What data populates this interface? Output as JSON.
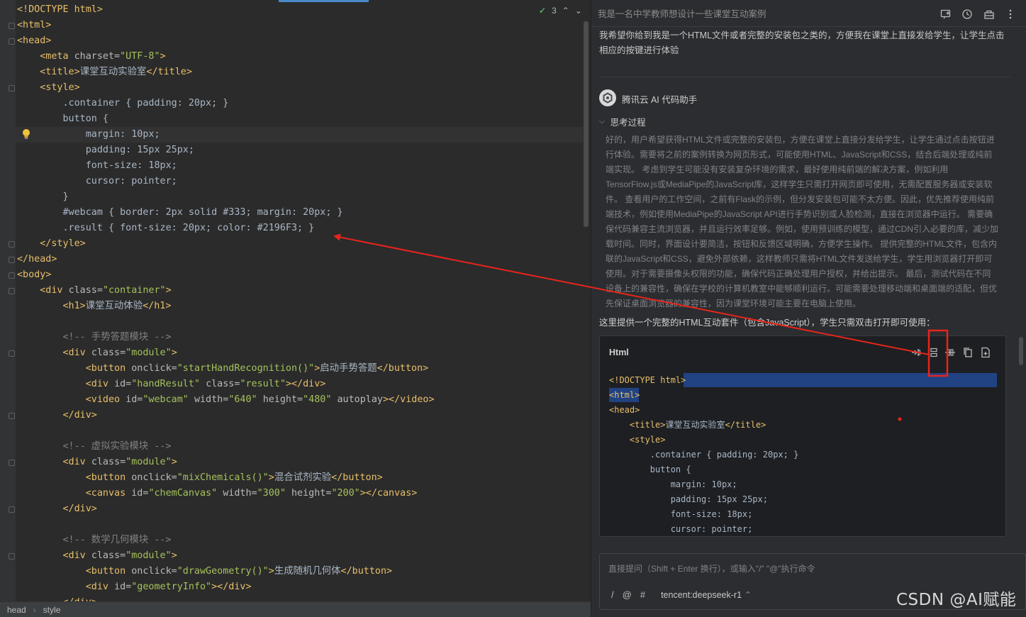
{
  "editor": {
    "inspection_count": "3",
    "lines": [
      [
        [
          "tag",
          "<!DOCTYPE html>"
        ]
      ],
      [
        [
          "tag",
          "<html>"
        ]
      ],
      [
        [
          "tag",
          "<head>"
        ]
      ],
      [
        [
          "tag",
          "    <meta "
        ],
        [
          "attr",
          "charset="
        ],
        [
          "str",
          "\"UTF-8\""
        ],
        [
          "tag",
          ">"
        ]
      ],
      [
        [
          "tag",
          "    <title>"
        ],
        [
          "txt",
          "课堂互动实验室"
        ],
        [
          "tag",
          "</title>"
        ]
      ],
      [
        [
          "tag",
          "    <style>"
        ]
      ],
      [
        [
          "txt",
          "        .container { padding: 20px; }"
        ]
      ],
      [
        [
          "txt",
          "        button {"
        ]
      ],
      [
        [
          "txt",
          "            margin: 10px;"
        ]
      ],
      [
        [
          "txt",
          "            padding: 15px 25px;"
        ]
      ],
      [
        [
          "txt",
          "            font-size: 18px;"
        ]
      ],
      [
        [
          "txt",
          "            cursor: pointer;"
        ]
      ],
      [
        [
          "txt",
          "        }"
        ]
      ],
      [
        [
          "txt",
          "        #webcam { border: 2px solid #333; margin: 20px; }"
        ]
      ],
      [
        [
          "txt",
          "        .result { font-size: 20px; color: #2196F3; }"
        ]
      ],
      [
        [
          "tag",
          "    </style>"
        ]
      ],
      [
        [
          "tag",
          "</head>"
        ]
      ],
      [
        [
          "tag",
          "<body>"
        ]
      ],
      [
        [
          "tag",
          "    <div "
        ],
        [
          "attr",
          "class="
        ],
        [
          "str",
          "\"container\""
        ],
        [
          "tag",
          ">"
        ]
      ],
      [
        [
          "tag",
          "        <h1>"
        ],
        [
          "txt",
          "课堂互动体验"
        ],
        [
          "tag",
          "</h1>"
        ]
      ],
      [
        [
          "txt",
          ""
        ]
      ],
      [
        [
          "cmt",
          "        <!-- 手势答题模块 -->"
        ]
      ],
      [
        [
          "tag",
          "        <div "
        ],
        [
          "attr",
          "class="
        ],
        [
          "str",
          "\"module\""
        ],
        [
          "tag",
          ">"
        ]
      ],
      [
        [
          "tag",
          "            <button "
        ],
        [
          "attr",
          "onclick="
        ],
        [
          "str",
          "\"startHandRecognition()\""
        ],
        [
          "tag",
          ">"
        ],
        [
          "txt",
          "启动手势答题"
        ],
        [
          "tag",
          "</button>"
        ]
      ],
      [
        [
          "tag",
          "            <div "
        ],
        [
          "attr",
          "id="
        ],
        [
          "str",
          "\"handResult\" "
        ],
        [
          "attr",
          "class="
        ],
        [
          "str",
          "\"result\""
        ],
        [
          "tag",
          "></div>"
        ]
      ],
      [
        [
          "tag",
          "            <video "
        ],
        [
          "attr",
          "id="
        ],
        [
          "str",
          "\"webcam\" "
        ],
        [
          "attr",
          "width="
        ],
        [
          "str",
          "\"640\" "
        ],
        [
          "attr",
          "height="
        ],
        [
          "str",
          "\"480\" "
        ],
        [
          "attr",
          "autoplay"
        ],
        [
          "tag",
          "></video>"
        ]
      ],
      [
        [
          "tag",
          "        </div>"
        ]
      ],
      [
        [
          "txt",
          ""
        ]
      ],
      [
        [
          "cmt",
          "        <!-- 虚拟实验模块 -->"
        ]
      ],
      [
        [
          "tag",
          "        <div "
        ],
        [
          "attr",
          "class="
        ],
        [
          "str",
          "\"module\""
        ],
        [
          "tag",
          ">"
        ]
      ],
      [
        [
          "tag",
          "            <button "
        ],
        [
          "attr",
          "onclick="
        ],
        [
          "str",
          "\"mixChemicals()\""
        ],
        [
          "tag",
          ">"
        ],
        [
          "txt",
          "混合试剂实验"
        ],
        [
          "tag",
          "</button>"
        ]
      ],
      [
        [
          "tag",
          "            <canvas "
        ],
        [
          "attr",
          "id="
        ],
        [
          "str",
          "\"chemCanvas\" "
        ],
        [
          "attr",
          "width="
        ],
        [
          "str",
          "\"300\" "
        ],
        [
          "attr",
          "height="
        ],
        [
          "str",
          "\"200\""
        ],
        [
          "tag",
          "></canvas>"
        ]
      ],
      [
        [
          "tag",
          "        </div>"
        ]
      ],
      [
        [
          "txt",
          ""
        ]
      ],
      [
        [
          "cmt",
          "        <!-- 数学几何模块 -->"
        ]
      ],
      [
        [
          "tag",
          "        <div "
        ],
        [
          "attr",
          "class="
        ],
        [
          "str",
          "\"module\""
        ],
        [
          "tag",
          ">"
        ]
      ],
      [
        [
          "tag",
          "            <button "
        ],
        [
          "attr",
          "onclick="
        ],
        [
          "str",
          "\"drawGeometry()\""
        ],
        [
          "tag",
          ">"
        ],
        [
          "txt",
          "生成随机几何体"
        ],
        [
          "tag",
          "</button>"
        ]
      ],
      [
        [
          "tag",
          "            <div "
        ],
        [
          "attr",
          "id="
        ],
        [
          "str",
          "\"geometryInfo\""
        ],
        [
          "tag",
          "></div>"
        ]
      ],
      [
        [
          "tag",
          "        </div>"
        ]
      ]
    ]
  },
  "statusbar": {
    "crumbs": [
      "head",
      "style"
    ]
  },
  "ai_panel": {
    "title": "我是一名中学教师想设计一些课堂互动案例",
    "user_message": "我希望你给到我是一个HTML文件或者完整的安装包之类的，方便我在课堂上直接发给学生，让学生点击相应的按键进行体验",
    "bot_name": "腾讯云 AI 代码助手",
    "thinking_label": "思考过程",
    "thinking_text": "好的，用户希望获得HTML文件或完整的安装包，方便在课堂上直接分发给学生，让学生通过点击按钮进行体验。需要将之前的案例转换为网页形式，可能使用HTML、JavaScript和CSS，结合后端处理或纯前端实现。 考虑到学生可能没有安装复杂环境的需求，最好使用纯前端的解决方案，例如利用TensorFlow.js或MediaPipe的JavaScript库，这样学生只需打开网页即可使用，无需配置服务器或安装软件。 查看用户的工作空间，之前有Flask的示例，但分发安装包可能不太方便。因此，优先推荐使用纯前端技术，例如使用MediaPipe的JavaScript API进行手势识别或人脸检测，直接在浏览器中运行。 需要确保代码兼容主流浏览器，并且运行效率足够。例如，使用预训练的模型，通过CDN引入必要的库，减少加载时间。同时，界面设计要简洁，按钮和反馈区域明确，方便学生操作。 提供完整的HTML文件，包含内联的JavaScript和CSS，避免外部依赖，这样教师只需将HTML文件发送给学生，学生用浏览器打开即可使用。对于需要摄像头权限的功能，确保代码正确处理用户授权，并给出提示。 最后，测试代码在不同设备上的兼容性，确保在学校的计算机教室中能够顺利运行。可能需要处理移动端和桌面端的适配，但优先保证桌面浏览器的兼容性，因为课堂环境可能主要在电脑上使用。",
    "intro_line": "这里提供一个完整的HTML互动套件（包含JavaScript），学生只需双击打开即可使用：",
    "code_lang": "Html",
    "code_lines": [
      [
        [
          "tag",
          "<!DOCTYPE html>"
        ]
      ],
      [
        [
          "tag",
          "<html>"
        ]
      ],
      [
        [
          "tag",
          "<head>"
        ]
      ],
      [
        [
          "tag",
          "    <title>"
        ],
        [
          "txt",
          "课堂互动实验室"
        ],
        [
          "tag",
          "</title>"
        ]
      ],
      [
        [
          "tag",
          "    <style>"
        ]
      ],
      [
        [
          "txt",
          "        .container { padding: 20px; }"
        ]
      ],
      [
        [
          "txt",
          "        button {"
        ]
      ],
      [
        [
          "txt",
          "            margin: 10px;"
        ]
      ],
      [
        [
          "txt",
          "            padding: 15px 25px;"
        ]
      ],
      [
        [
          "txt",
          "            font-size: 18px;"
        ]
      ],
      [
        [
          "txt",
          "            cursor: pointer;"
        ]
      ]
    ],
    "input_placeholder": "直接提问（Shift + Enter 换行），或输入\"/\" \"@\"执行命令",
    "input_tools": [
      "/",
      "@",
      "#"
    ],
    "model": "tencent:deepseek-r1"
  },
  "watermark": "CSDN @AI赋能",
  "colors": {
    "annotation": "#e8241c",
    "selection": "#214283"
  }
}
